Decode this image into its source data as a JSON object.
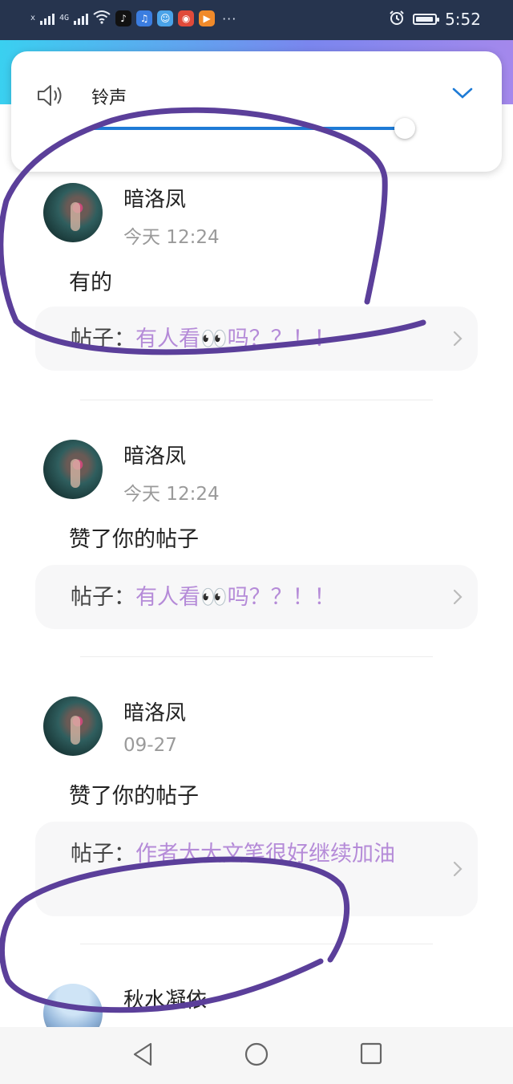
{
  "status_bar": {
    "signal_text_1": "x",
    "signal_text_2": "4G",
    "time": "5:52",
    "app_icons": [
      "tiktok-icon",
      "app-music-icon",
      "app-chat-icon",
      "app-red-icon",
      "app-video-icon"
    ],
    "overflow": "···"
  },
  "volume_panel": {
    "label": "铃声",
    "level": 0.97
  },
  "notifications": [
    {
      "user": "暗洛凤",
      "time": "今天 12:24",
      "message": "有的",
      "post_label": "帖子：",
      "post_title": "有人看👀吗？？！！"
    },
    {
      "user": "暗洛凤",
      "time": "今天 12:24",
      "message": "赞了你的帖子",
      "post_label": "帖子：",
      "post_title": "有人看👀吗？？！！"
    },
    {
      "user": "暗洛凤",
      "time": "09-27",
      "message": "赞了你的帖子",
      "post_label": "帖子：",
      "post_title": "作者大大文笔很好继续加油"
    },
    {
      "user": "秋水凝依",
      "time": ""
    }
  ],
  "colors": {
    "status_bar_bg": "#26344e",
    "slider_accent": "#1e7bd6",
    "post_title": "#b58bd8",
    "annotation_ink": "#5b3f9a"
  }
}
